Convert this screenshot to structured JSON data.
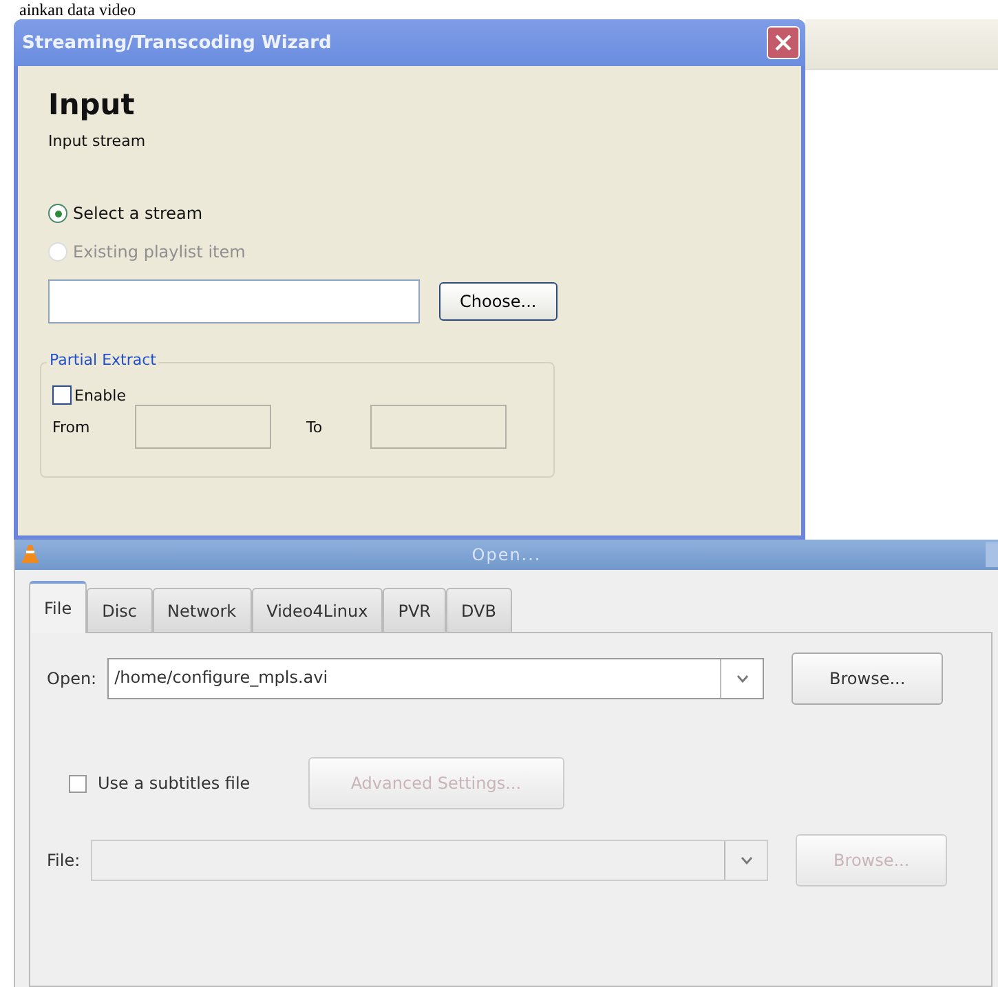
{
  "page_caption": "ainkan data video",
  "wizard": {
    "title": "Streaming/Transcoding Wizard",
    "heading": "Input",
    "subheading": "Input stream",
    "radios": [
      {
        "label": "Select a stream",
        "selected": true,
        "disabled": false
      },
      {
        "label": "Existing playlist item",
        "selected": false,
        "disabled": true
      }
    ],
    "choose_button": "Choose...",
    "partial_extract": {
      "title": "Partial Extract",
      "enable": {
        "label": "Enable",
        "checked": false
      },
      "from_label": "From",
      "to_label": "To"
    }
  },
  "open_dialog": {
    "title": "Open...",
    "tabs": [
      {
        "label": "File",
        "selected": true
      },
      {
        "label": "Disc",
        "selected": false
      },
      {
        "label": "Network",
        "selected": false
      },
      {
        "label": "Video4Linux",
        "selected": false
      },
      {
        "label": "PVR",
        "selected": false
      },
      {
        "label": "DVB",
        "selected": false
      }
    ],
    "open_label": "Open:",
    "open_value": "/home/configure_mpls.avi",
    "browse_button": "Browse...",
    "subtitles": {
      "label": "Use a subtitles file",
      "checked": false
    },
    "advanced_button": {
      "label": "Advanced Settings...",
      "disabled": true
    },
    "file_label": "File:",
    "file_browse_button": {
      "label": "Browse...",
      "disabled": true
    }
  }
}
